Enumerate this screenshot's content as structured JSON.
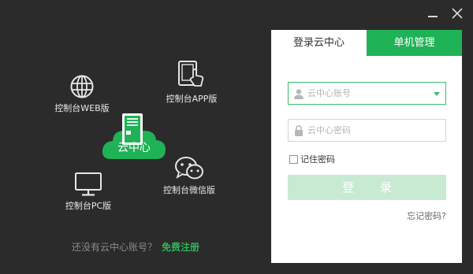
{
  "window": {
    "minimize_icon": "minimize-icon",
    "close_icon": "close-icon"
  },
  "features": {
    "web": {
      "label": "控制台WEB版",
      "icon": "globe-icon"
    },
    "app": {
      "label": "控制台APP版",
      "icon": "tablet-touch-icon"
    },
    "cloud": {
      "label": "云中心",
      "icon": "cloud-server-icon"
    },
    "wechat": {
      "label": "控制台微信版",
      "icon": "wechat-icon"
    },
    "pc": {
      "label": "控制台PC版",
      "icon": "monitor-icon"
    }
  },
  "signup": {
    "prompt": "还没有云中心账号？",
    "link": "免费注册"
  },
  "login_panel": {
    "tabs": [
      {
        "label": "登录云中心",
        "active": true
      },
      {
        "label": "单机管理",
        "active": false
      }
    ],
    "account_placeholder": "云中心账号",
    "password_placeholder": "云中心密码",
    "remember_label": "记住密码",
    "login_button": "登 录",
    "forgot_link": "忘记密码?"
  },
  "colors": {
    "accent": "#1fb256",
    "background": "#2b2b2b",
    "login_button_disabled": "#c8ead3"
  }
}
